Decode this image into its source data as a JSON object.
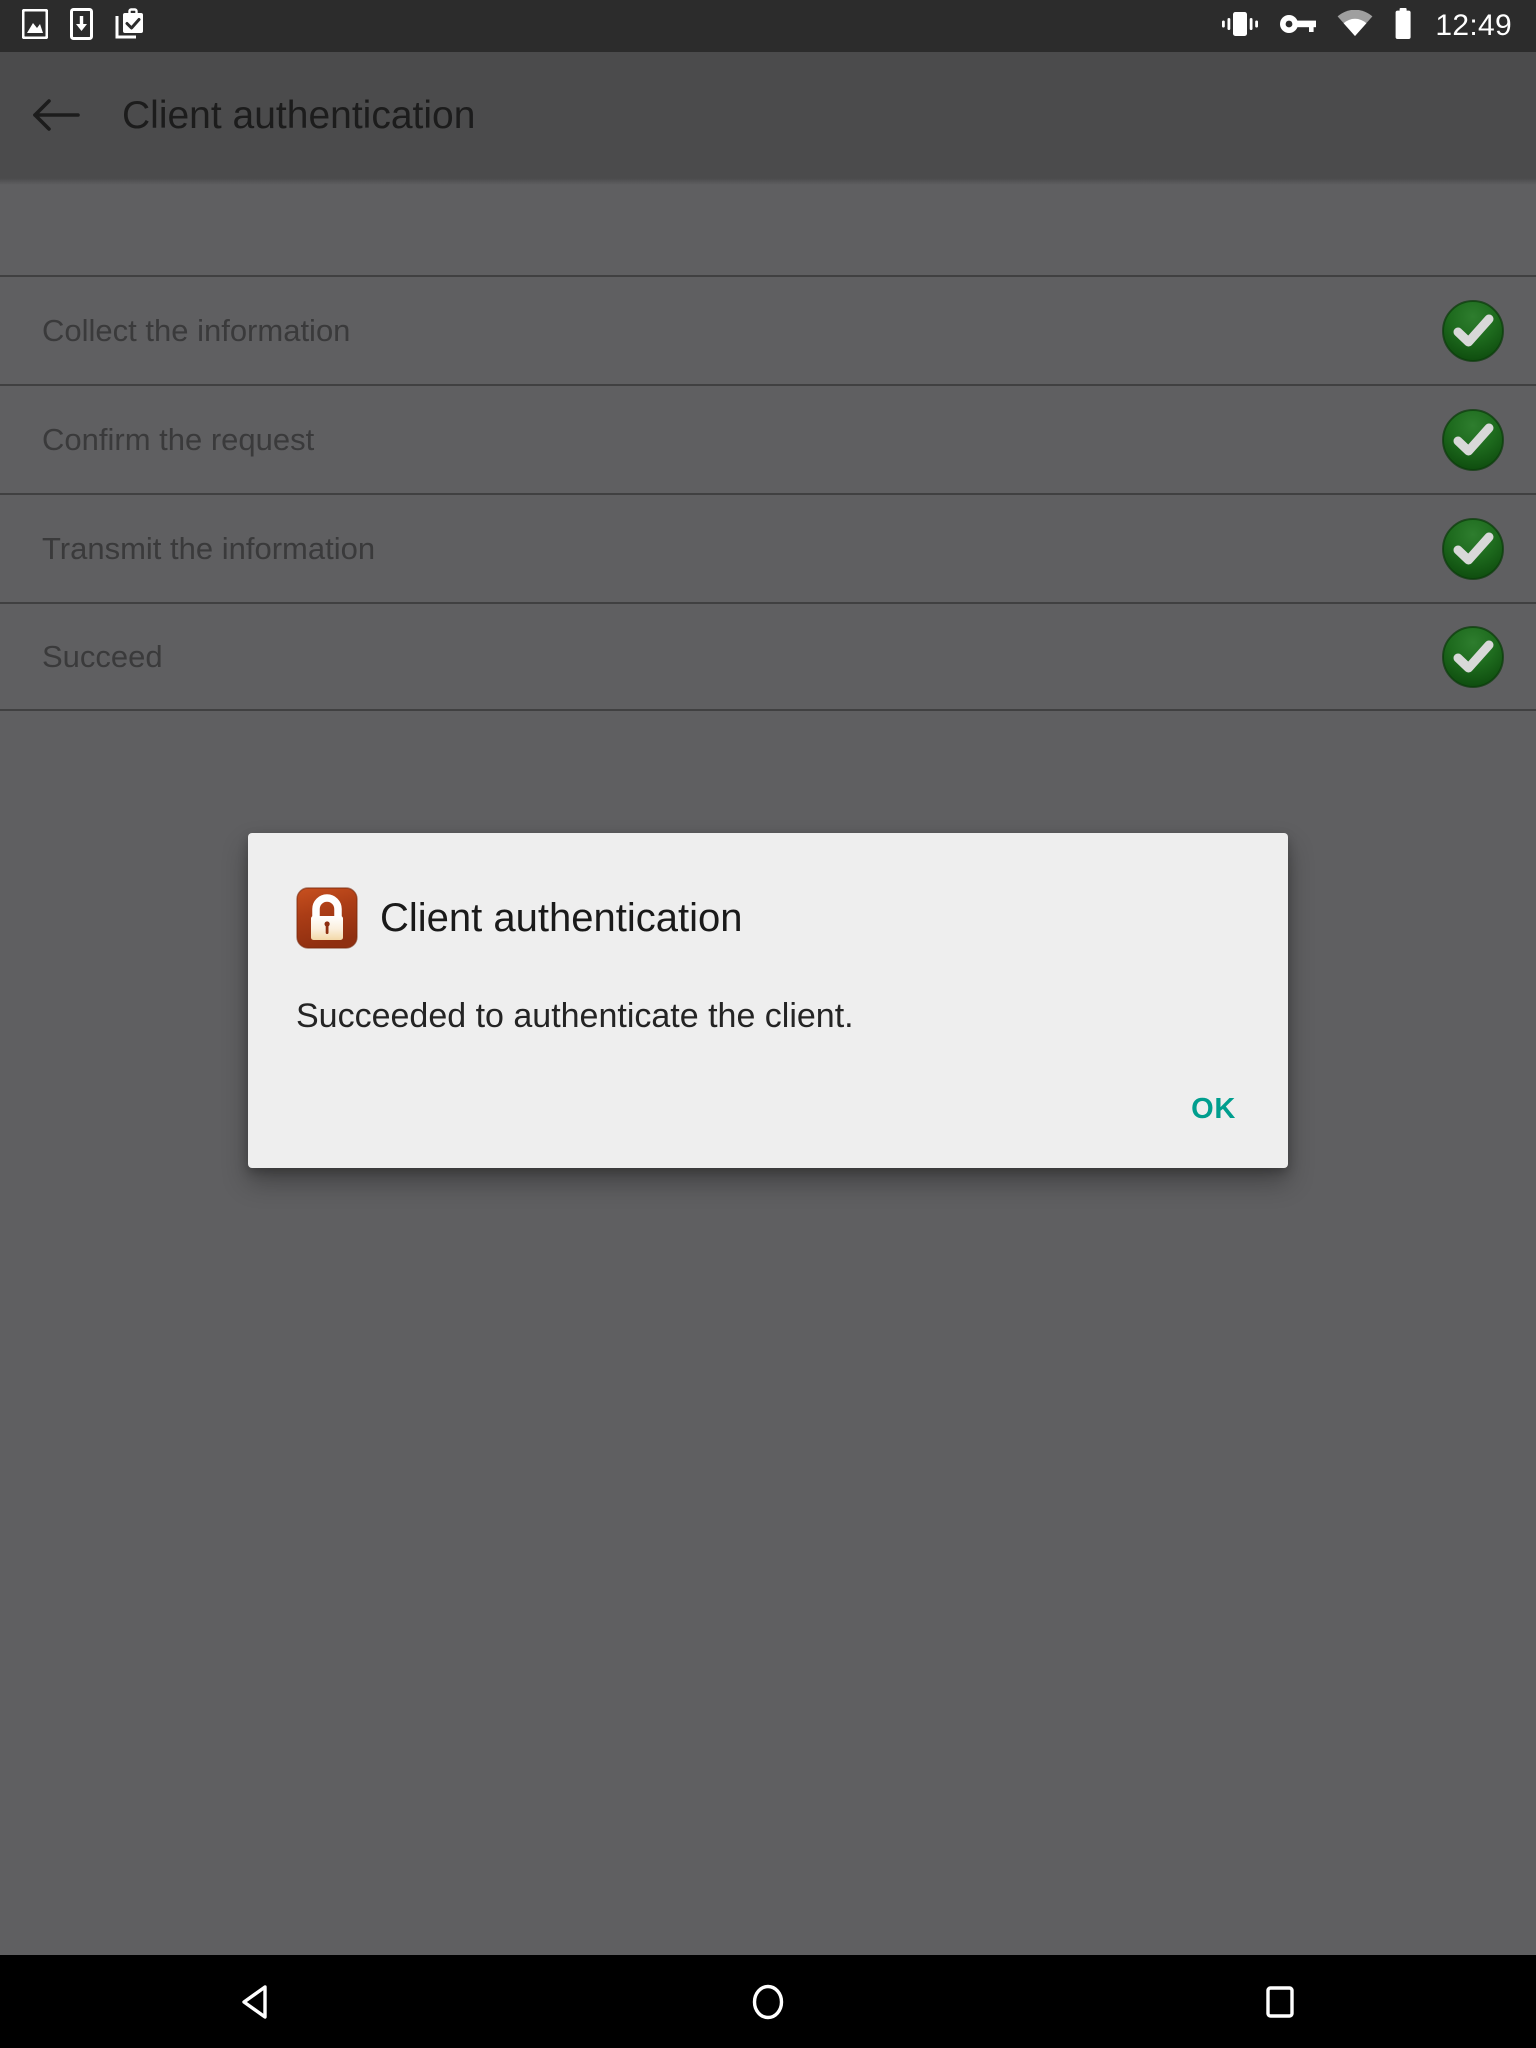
{
  "status_bar": {
    "left_icons": [
      {
        "name": "screenshot-icon",
        "label": "Screenshot captured"
      },
      {
        "name": "download-icon",
        "label": "Download"
      },
      {
        "name": "work-profile-check-icon",
        "label": "Work profile"
      }
    ],
    "right_icons": [
      {
        "name": "vibrate-icon",
        "label": "Vibrate"
      },
      {
        "name": "vpn-key-icon",
        "label": "VPN key"
      },
      {
        "name": "wifi-icon",
        "label": "Wi-Fi"
      },
      {
        "name": "battery-full-icon",
        "label": "Battery full"
      }
    ],
    "clock": "12:49"
  },
  "app_bar": {
    "back_label": "Navigate up",
    "title": "Client authentication"
  },
  "steps": [
    {
      "label": "Collect the information",
      "status": "done"
    },
    {
      "label": "Confirm the request",
      "status": "done"
    },
    {
      "label": "Transmit the information",
      "status": "done"
    },
    {
      "label": "Succeed",
      "status": "done"
    }
  ],
  "dialog": {
    "icon": "lock-icon",
    "title": "Client authentication",
    "message": "Succeeded to authenticate the client.",
    "positive_button": "OK"
  },
  "nav_bar": {
    "back": "Back",
    "home": "Home",
    "recents": "Recent apps"
  },
  "colors": {
    "scrim": "#5f5f61",
    "app_bar": "#4b4b4c",
    "status_bar": "#2c2c2c",
    "dialog_surface": "#eeeeee",
    "accent_teal": "#009e8e",
    "lock_orange": "#b8401a",
    "check_green": "#1f7a1f",
    "nav_bar": "#000000"
  }
}
